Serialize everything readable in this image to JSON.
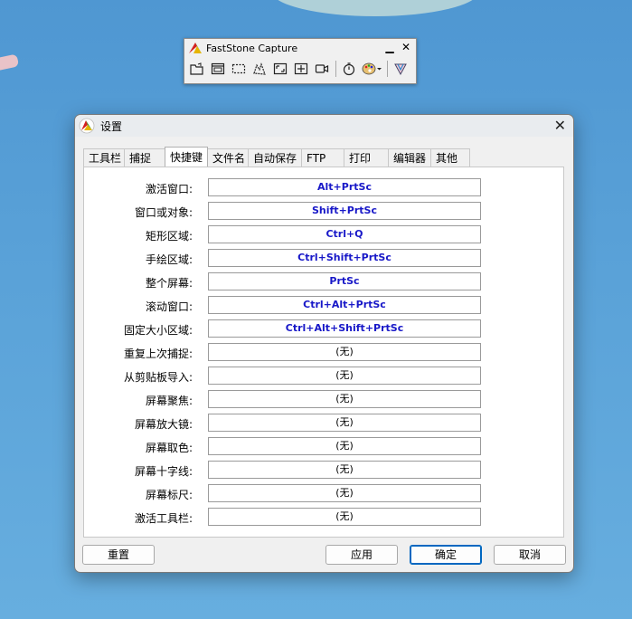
{
  "toolbar": {
    "title": "FastStone Capture",
    "minimize_glyph": "▁",
    "close_glyph": "✕",
    "tools": [
      "open-folder-icon",
      "capture-window-icon",
      "capture-rect-icon",
      "capture-freehand-icon",
      "capture-fullscreen-icon",
      "capture-fixed-icon",
      "record-video-icon",
      "timer-icon",
      "color-picker-icon",
      "options-icon"
    ]
  },
  "dialog": {
    "title": "设置",
    "close_glyph": "✕",
    "tabs": [
      "工具栏",
      "捕捉",
      "快捷键",
      "文件名",
      "自动保存",
      "FTP",
      "打印",
      "编辑器",
      "其他"
    ],
    "active_tab": "快捷键",
    "rows": [
      {
        "label": "激活窗口:",
        "value": "Alt+PrtSc"
      },
      {
        "label": "窗口或对象:",
        "value": "Shift+PrtSc"
      },
      {
        "label": "矩形区域:",
        "value": "Ctrl+Q"
      },
      {
        "label": "手绘区域:",
        "value": "Ctrl+Shift+PrtSc"
      },
      {
        "label": "整个屏幕:",
        "value": "PrtSc"
      },
      {
        "label": "滚动窗口:",
        "value": "Ctrl+Alt+PrtSc"
      },
      {
        "label": "固定大小区域:",
        "value": "Ctrl+Alt+Shift+PrtSc"
      },
      {
        "label": "重复上次捕捉:",
        "value": "(无)"
      },
      {
        "label": "从剪贴板导入:",
        "value": "(无)"
      },
      {
        "label": "屏幕聚焦:",
        "value": "(无)"
      },
      {
        "label": "屏幕放大镜:",
        "value": "(无)"
      },
      {
        "label": "屏幕取色:",
        "value": "(无)"
      },
      {
        "label": "屏幕十字线:",
        "value": "(无)"
      },
      {
        "label": "屏幕标尺:",
        "value": "(无)"
      },
      {
        "label": "激活工具栏:",
        "value": "(无)"
      }
    ],
    "buttons": {
      "reset": "重置",
      "apply": "应用",
      "ok": "确定",
      "cancel": "取消"
    }
  },
  "colors": {
    "hotkey_text": "#1818c8",
    "default_button_border": "#0067c0",
    "desktop": "#5aa2d8"
  }
}
